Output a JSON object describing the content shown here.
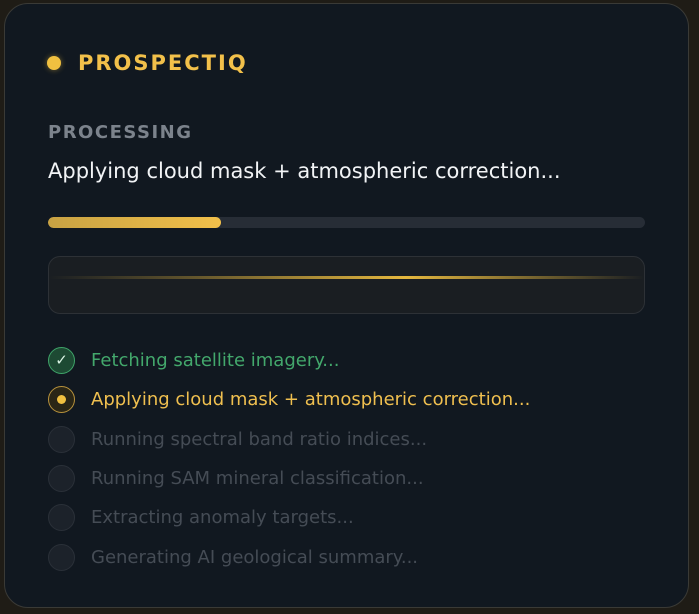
{
  "brand": {
    "name": "PROSPECTIQ",
    "accent_color": "#f0c040"
  },
  "status": {
    "section_label": "PROCESSING",
    "current_step": "Applying cloud mask + atmospheric correction...",
    "progress_fraction": 0.29
  },
  "steps": [
    {
      "label": "Fetching satellite imagery...",
      "state": "done",
      "icon": "check-icon"
    },
    {
      "label": "Applying cloud mask + atmospheric correction...",
      "state": "active",
      "icon": "active-dot-icon"
    },
    {
      "label": "Running spectral band ratio indices...",
      "state": "pending",
      "icon": "pending-circle-icon"
    },
    {
      "label": "Running SAM mineral classification...",
      "state": "pending",
      "icon": "pending-circle-icon"
    },
    {
      "label": "Extracting anomaly targets...",
      "state": "pending",
      "icon": "pending-circle-icon"
    },
    {
      "label": "Generating AI geological summary...",
      "state": "pending",
      "icon": "pending-circle-icon"
    }
  ],
  "colors": {
    "done": "#43a86c",
    "active": "#efbf4f",
    "pending": "#454c55"
  }
}
